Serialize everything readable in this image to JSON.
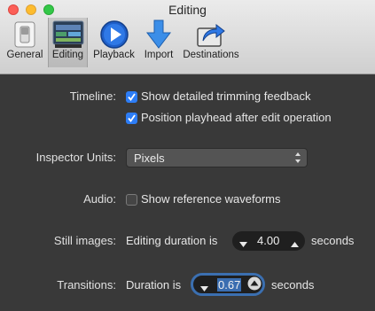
{
  "window": {
    "title": "Editing"
  },
  "tabs": [
    {
      "label": "General",
      "icon": "switch-icon"
    },
    {
      "label": "Editing",
      "icon": "timeline-icon"
    },
    {
      "label": "Playback",
      "icon": "play-icon"
    },
    {
      "label": "Import",
      "icon": "download-arrow-icon"
    },
    {
      "label": "Destinations",
      "icon": "share-icon"
    }
  ],
  "selected_tab": "Editing",
  "timeline": {
    "label": "Timeline:",
    "option1": {
      "text": "Show detailed trimming feedback",
      "checked": true
    },
    "option2": {
      "text": "Position playhead after edit operation",
      "checked": true
    }
  },
  "inspector_units": {
    "label": "Inspector Units:",
    "value": "Pixels"
  },
  "audio": {
    "label": "Audio:",
    "option": {
      "text": "Show reference waveforms",
      "checked": false
    }
  },
  "still_images": {
    "label": "Still images:",
    "prefix": "Editing duration is",
    "value": "4.00",
    "suffix": "seconds"
  },
  "transitions": {
    "label": "Transitions:",
    "prefix": "Duration is",
    "value": "0.67",
    "suffix": "seconds"
  },
  "colors": {
    "accent": "#2d7df6",
    "focus_ring": "#3b6fb0",
    "background": "#393939"
  }
}
